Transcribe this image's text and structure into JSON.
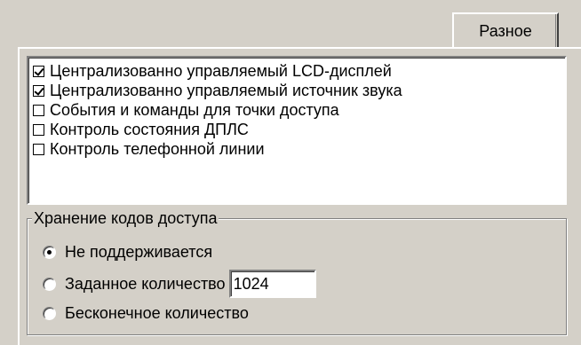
{
  "tab": {
    "label": "Разное"
  },
  "options_list": {
    "items": [
      {
        "label": "Централизованно управляемый LCD-дисплей",
        "checked": true
      },
      {
        "label": "Централизованно управляемый источник звука",
        "checked": true
      },
      {
        "label": "События и команды для точки доступа",
        "checked": false
      },
      {
        "label": "Контроль состояния ДПЛС",
        "checked": false
      },
      {
        "label": "Контроль телефонной линии",
        "checked": false
      }
    ]
  },
  "access_codes": {
    "title": "Хранение кодов доступа",
    "options": [
      {
        "label": "Не поддерживается",
        "selected": true
      },
      {
        "label": "Заданное количество",
        "selected": false
      },
      {
        "label": "Бесконечное количество",
        "selected": false
      }
    ],
    "count_value": "1024"
  }
}
